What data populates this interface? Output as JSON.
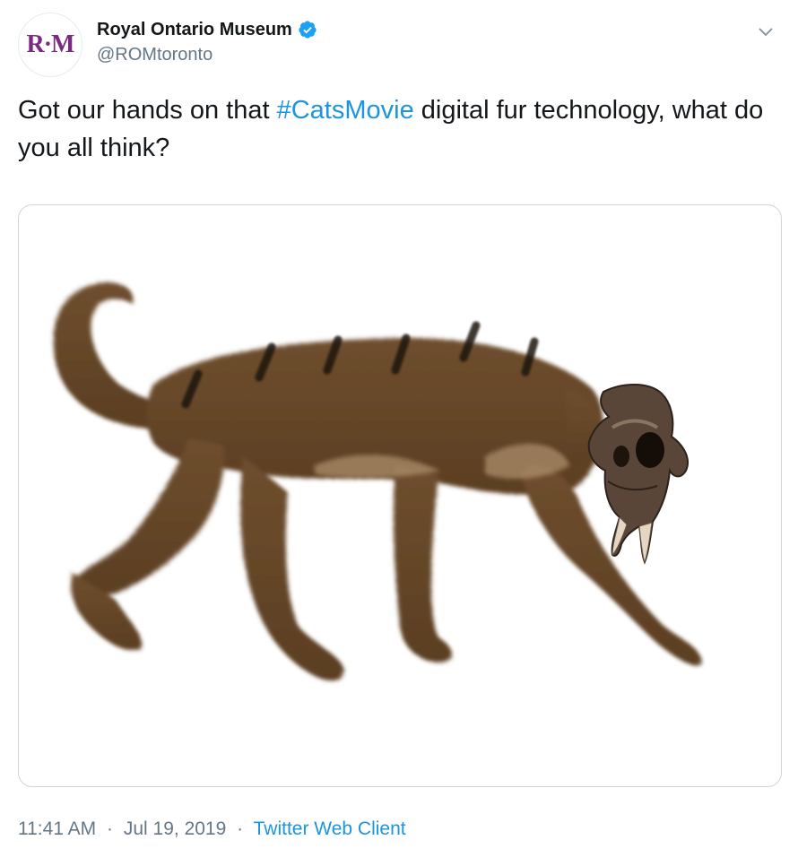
{
  "account": {
    "avatar_text": "R·M",
    "display_name": "Royal Ontario Museum",
    "handle": "@ROMtoronto",
    "verified": true,
    "verified_icon": "verified-badge-icon",
    "brand_color": "#7b2a82"
  },
  "tweet": {
    "text_before": "Got our hands on that ",
    "hashtag": "#CatsMovie",
    "text_after": " digital fur technology, what do you all think?"
  },
  "media": {
    "icon": "furry-cat-with-sabertooth-skull-image"
  },
  "meta": {
    "time": "11:41 AM",
    "separator1": "·",
    "date": "Jul 19, 2019",
    "separator2": "·",
    "source": "Twitter Web Client"
  },
  "colors": {
    "link": "#1b95e0",
    "secondary_text": "#657786",
    "border": "#ccd6dd",
    "fur": "#6b4a2b"
  }
}
